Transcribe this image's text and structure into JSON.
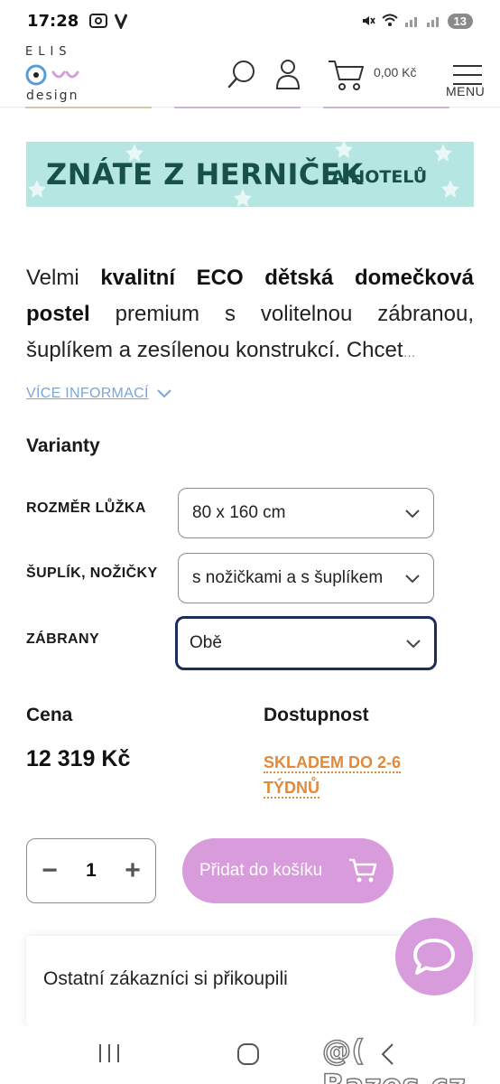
{
  "status_bar": {
    "time": "17:28",
    "left_icons": [
      "screenshot-icon",
      "v-icon"
    ],
    "battery_badge": "13"
  },
  "header": {
    "logo_top": "ELIS",
    "logo_bottom": "design",
    "cart_price": "0,00 Kč",
    "menu_label": "MENU"
  },
  "banner": {
    "text_main": "ZNÁTE Z HERNIČEK",
    "text_secondary": "A HOTELŮ",
    "color": "#b6e6e2"
  },
  "description": {
    "text_1": "Velmi ",
    "bold_1": "kvalitní ECO dětská domečková postel",
    "text_2": " premium s volitelnou zábranou, šuplíkem a zesílenou konstrukcí. Chcet",
    "ellipsis": "…",
    "more_info": "VÍCE INFORMACÍ"
  },
  "variants": {
    "title": "Varianty",
    "items": [
      {
        "label": "ROZMĚR LŮŽKA",
        "value": "80 x 160 cm"
      },
      {
        "label": "ŠUPLÍK, NOŽIČKY",
        "value": "s nožičkami a s šuplíkem"
      },
      {
        "label": "ZÁBRANY",
        "value": "Obě"
      }
    ]
  },
  "pricing": {
    "price_label": "Cena",
    "price": "12 319 Kč",
    "availability_label": "Dostupnost",
    "availability": "SKLADEM DO 2-6 TÝDNŮ",
    "availability_color": "#e08a3c"
  },
  "purchase": {
    "minus": "−",
    "quantity": "1",
    "plus": "+",
    "add_to_cart": "Přidat do košíku",
    "button_color": "#d89bdc"
  },
  "customers": {
    "title": "Ostatní zákazníci si přikoupili"
  },
  "watermark": "@( Bazos.cz"
}
